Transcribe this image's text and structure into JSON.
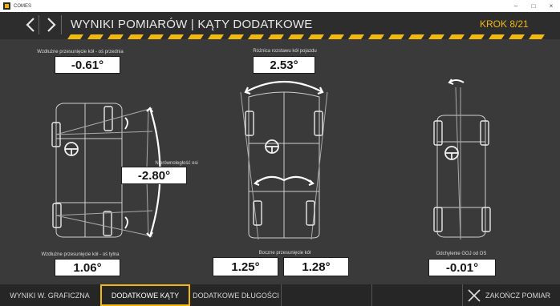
{
  "window": {
    "app_name": "COMES",
    "minimize": "–",
    "maximize": "□",
    "close": "×"
  },
  "header": {
    "title": "WYNIKI POMIARÓW | KĄTY DODATKOWE",
    "step": "KROK 8/21",
    "accent_color": "#f2b80c"
  },
  "panels": {
    "front_offset_label": "Wzdłużne przesunięcie kół - oś przednia",
    "front_offset_value": "-0.61°",
    "axle_misalign_label": "Nierównoległość osi",
    "axle_misalign_value": "-2.80°",
    "rear_offset_label": "Wzdłużne przesunięcie kół - oś tylna",
    "rear_offset_value": "1.06°",
    "track_diff_label": "Różnica rozstawu kół pojazdu",
    "track_diff_value": "2.53°",
    "lateral_offset_label": "Boczne przesunięcie kół",
    "lateral_offset_left": "1.25°",
    "lateral_offset_right": "1.28°",
    "goj_label": "Odchylenie GOJ od OS",
    "goj_value": "-0.01°"
  },
  "tabs": [
    "WYNIKI W. GRAFICZNA",
    "DODATKOWE KĄTY",
    "DODATKOWE DŁUGOŚCI"
  ],
  "finish_label": "ZAKOŃCZ POMIAR"
}
